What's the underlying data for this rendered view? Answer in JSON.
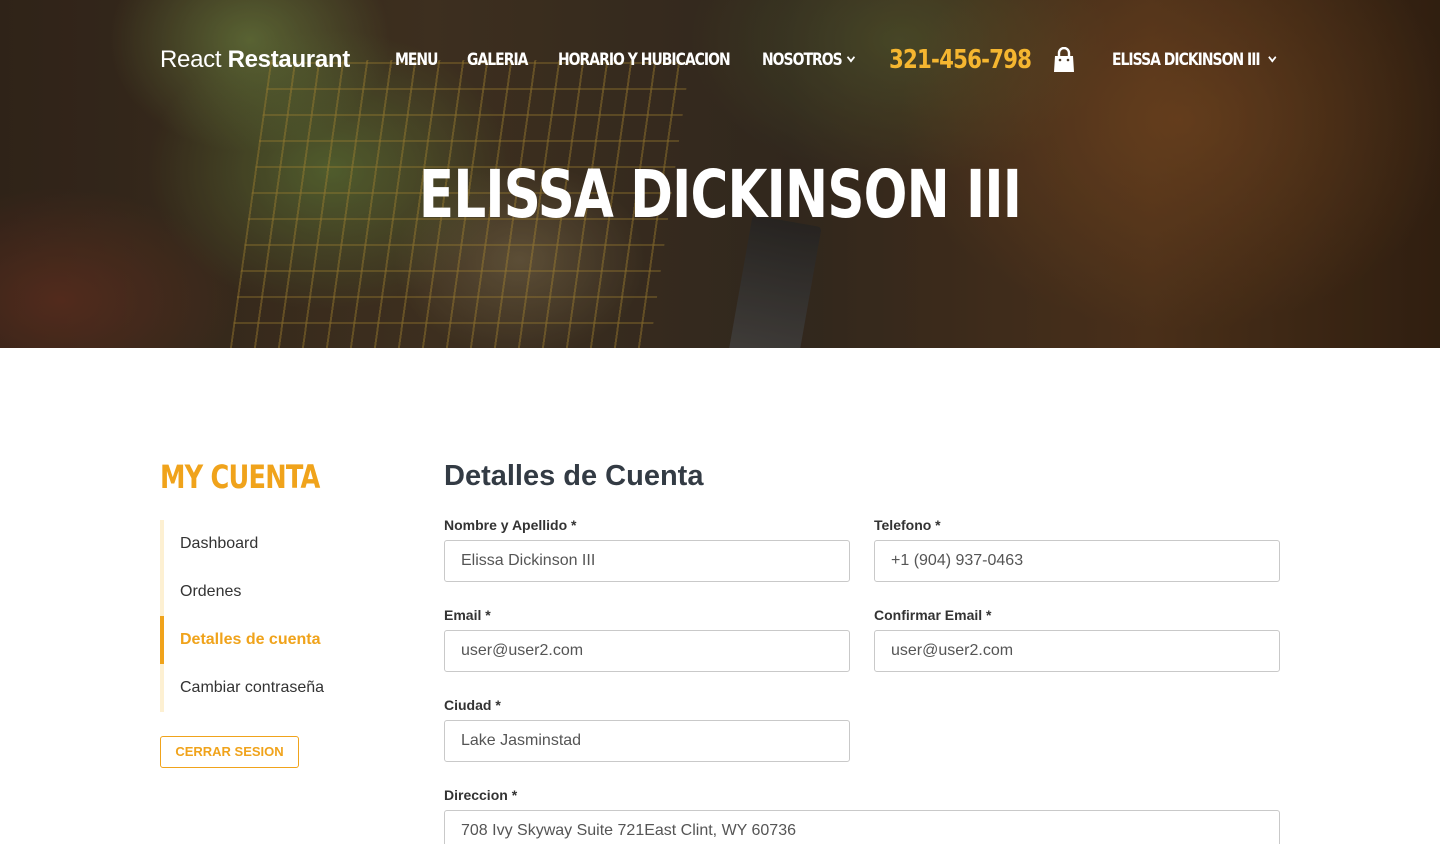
{
  "header": {
    "logo": {
      "light": "React",
      "bold": "Restaurant"
    },
    "nav": [
      "MENU",
      "GALERIA",
      "HORARIO Y HUBICACION",
      "NOSOTROS"
    ],
    "phone": "321-456-798",
    "user_menu": "ELISSA DICKINSON III",
    "icons": {
      "cart": "shopping-bag-icon",
      "dropdown": "chevron-down-icon"
    }
  },
  "hero": {
    "title": "ELISSA DICKINSON III"
  },
  "sidebar": {
    "title": "MY CUENTA",
    "items": [
      {
        "label": "Dashboard",
        "active": false
      },
      {
        "label": "Ordenes",
        "active": false
      },
      {
        "label": "Detalles de cuenta",
        "active": true
      },
      {
        "label": "Cambiar contraseña",
        "active": false
      }
    ],
    "logout": "CERRAR SESION"
  },
  "form": {
    "title": "Detalles de Cuenta",
    "fields": {
      "name": {
        "label": "Nombre y Apellido *",
        "value": "Elissa Dickinson III"
      },
      "phone": {
        "label": "Telefono *",
        "value": "+1 (904) 937-0463"
      },
      "email": {
        "label": "Email *",
        "value": "user@user2.com"
      },
      "confirm_email": {
        "label": "Confirmar Email *",
        "value": "user@user2.com"
      },
      "city": {
        "label": "Ciudad *",
        "value": "Lake Jasminstad"
      },
      "address": {
        "label": "Direccion *",
        "value": "708 Ivy Skyway Suite 721East Clint, WY 60736"
      }
    }
  },
  "colors": {
    "accent": "#f0a31b",
    "phone": "#f5b630",
    "heading": "#333b44"
  }
}
